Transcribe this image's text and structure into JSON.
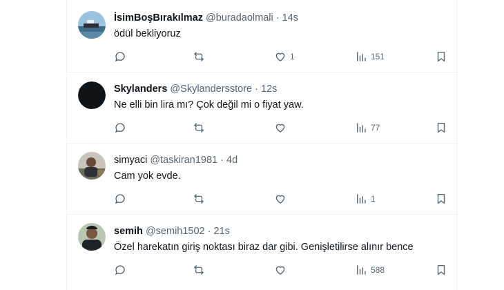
{
  "replies": [
    {
      "name": "İsimBoşBırakılmaz",
      "handle": "@buradaolmali",
      "time": "14s",
      "text": "ödül bekliyoruz",
      "likes": "1",
      "views": "151",
      "avatar": "boat-photo"
    },
    {
      "name": "Skylanders",
      "handle": "@Skylandersstore",
      "time": "12s",
      "text": "Ne elli bin lira mı? Çok değil mi o fiyat yaw.",
      "likes": "",
      "views": "77",
      "avatar": "black-circle"
    },
    {
      "name": "simyaci",
      "handle": "@taskiran1981",
      "time": "4d",
      "text": "Cam yok evde.",
      "likes": "",
      "views": "1",
      "avatar": "person-photo"
    },
    {
      "name": "semih",
      "handle": "@semih1502",
      "time": "21s",
      "text": "Özel harekatın giriş noktası biraz dar gibi. Genişletilirse alınır bence",
      "likes": "",
      "views": "588",
      "avatar": "person-photo"
    }
  ],
  "separator": "·",
  "colors": {
    "text": "#0f1419",
    "muted": "#536471",
    "divider": "#eff3f4"
  },
  "icons": [
    "reply-icon",
    "retweet-icon",
    "like-icon",
    "views-icon",
    "bookmark-icon"
  ]
}
